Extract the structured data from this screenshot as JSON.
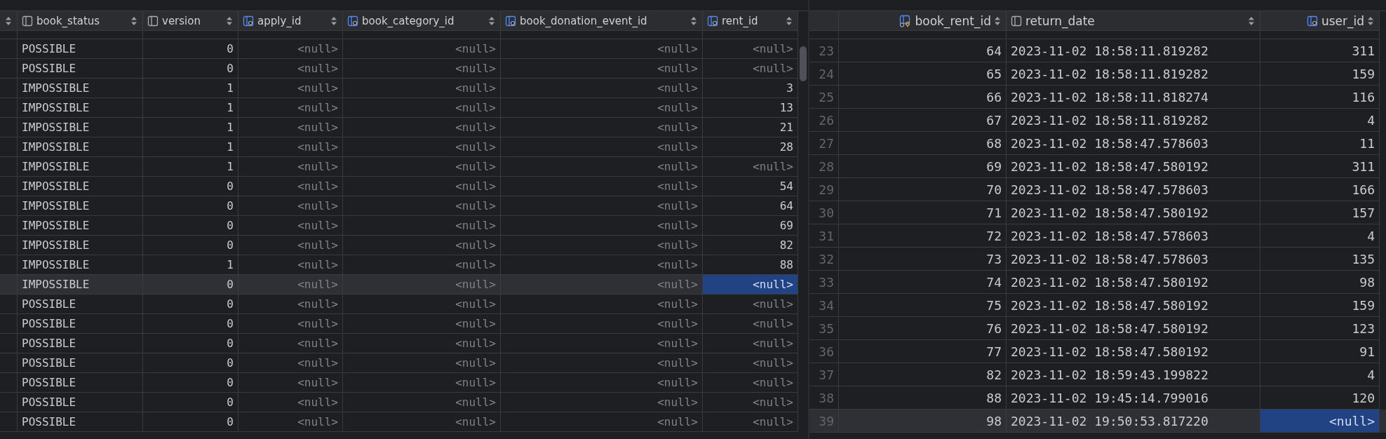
{
  "left_table": {
    "columns": [
      {
        "name": "book_status",
        "kind": "column",
        "numeric": false
      },
      {
        "name": "version",
        "kind": "column",
        "numeric": true
      },
      {
        "name": "apply_id",
        "kind": "fk",
        "numeric": true
      },
      {
        "name": "book_category_id",
        "kind": "fk",
        "numeric": true
      },
      {
        "name": "book_donation_event_id",
        "kind": "fk",
        "numeric": true
      },
      {
        "name": "rent_id",
        "kind": "fk",
        "numeric": true
      }
    ],
    "rows": [
      {
        "selected": false,
        "cells": [
          "POSSIBLE",
          "0",
          {
            "v": "<null>",
            "null": true
          },
          {
            "v": "<null>",
            "null": true
          },
          {
            "v": "<null>",
            "null": true
          },
          {
            "v": "<null>",
            "null": true
          }
        ]
      },
      {
        "selected": false,
        "cells": [
          "POSSIBLE",
          "0",
          {
            "v": "<null>",
            "null": true
          },
          {
            "v": "<null>",
            "null": true
          },
          {
            "v": "<null>",
            "null": true
          },
          {
            "v": "<null>",
            "null": true
          }
        ]
      },
      {
        "selected": false,
        "cells": [
          "IMPOSSIBLE",
          "1",
          {
            "v": "<null>",
            "null": true
          },
          {
            "v": "<null>",
            "null": true
          },
          {
            "v": "<null>",
            "null": true
          },
          "3"
        ]
      },
      {
        "selected": false,
        "cells": [
          "IMPOSSIBLE",
          "1",
          {
            "v": "<null>",
            "null": true
          },
          {
            "v": "<null>",
            "null": true
          },
          {
            "v": "<null>",
            "null": true
          },
          "13"
        ]
      },
      {
        "selected": false,
        "cells": [
          "IMPOSSIBLE",
          "1",
          {
            "v": "<null>",
            "null": true
          },
          {
            "v": "<null>",
            "null": true
          },
          {
            "v": "<null>",
            "null": true
          },
          "21"
        ]
      },
      {
        "selected": false,
        "cells": [
          "IMPOSSIBLE",
          "1",
          {
            "v": "<null>",
            "null": true
          },
          {
            "v": "<null>",
            "null": true
          },
          {
            "v": "<null>",
            "null": true
          },
          "28"
        ]
      },
      {
        "selected": false,
        "cells": [
          "IMPOSSIBLE",
          "1",
          {
            "v": "<null>",
            "null": true
          },
          {
            "v": "<null>",
            "null": true
          },
          {
            "v": "<null>",
            "null": true
          },
          {
            "v": "<null>",
            "null": true
          }
        ]
      },
      {
        "selected": false,
        "cells": [
          "IMPOSSIBLE",
          "0",
          {
            "v": "<null>",
            "null": true
          },
          {
            "v": "<null>",
            "null": true
          },
          {
            "v": "<null>",
            "null": true
          },
          "54"
        ]
      },
      {
        "selected": false,
        "cells": [
          "IMPOSSIBLE",
          "0",
          {
            "v": "<null>",
            "null": true
          },
          {
            "v": "<null>",
            "null": true
          },
          {
            "v": "<null>",
            "null": true
          },
          "64"
        ]
      },
      {
        "selected": false,
        "cells": [
          "IMPOSSIBLE",
          "0",
          {
            "v": "<null>",
            "null": true
          },
          {
            "v": "<null>",
            "null": true
          },
          {
            "v": "<null>",
            "null": true
          },
          "69"
        ]
      },
      {
        "selected": false,
        "cells": [
          "IMPOSSIBLE",
          "0",
          {
            "v": "<null>",
            "null": true
          },
          {
            "v": "<null>",
            "null": true
          },
          {
            "v": "<null>",
            "null": true
          },
          "82"
        ]
      },
      {
        "selected": false,
        "cells": [
          "IMPOSSIBLE",
          "1",
          {
            "v": "<null>",
            "null": true
          },
          {
            "v": "<null>",
            "null": true
          },
          {
            "v": "<null>",
            "null": true
          },
          "88"
        ]
      },
      {
        "selected": true,
        "cells": [
          "IMPOSSIBLE",
          "0",
          {
            "v": "<null>",
            "null": true
          },
          {
            "v": "<null>",
            "null": true
          },
          {
            "v": "<null>",
            "null": true
          },
          {
            "v": "<null>",
            "null": true,
            "selected": true
          }
        ]
      },
      {
        "selected": false,
        "cells": [
          "POSSIBLE",
          "0",
          {
            "v": "<null>",
            "null": true
          },
          {
            "v": "<null>",
            "null": true
          },
          {
            "v": "<null>",
            "null": true
          },
          {
            "v": "<null>",
            "null": true
          }
        ]
      },
      {
        "selected": false,
        "cells": [
          "POSSIBLE",
          "0",
          {
            "v": "<null>",
            "null": true
          },
          {
            "v": "<null>",
            "null": true
          },
          {
            "v": "<null>",
            "null": true
          },
          {
            "v": "<null>",
            "null": true
          }
        ]
      },
      {
        "selected": false,
        "cells": [
          "POSSIBLE",
          "0",
          {
            "v": "<null>",
            "null": true
          },
          {
            "v": "<null>",
            "null": true
          },
          {
            "v": "<null>",
            "null": true
          },
          {
            "v": "<null>",
            "null": true
          }
        ]
      },
      {
        "selected": false,
        "cells": [
          "POSSIBLE",
          "0",
          {
            "v": "<null>",
            "null": true
          },
          {
            "v": "<null>",
            "null": true
          },
          {
            "v": "<null>",
            "null": true
          },
          {
            "v": "<null>",
            "null": true
          }
        ]
      },
      {
        "selected": false,
        "cells": [
          "POSSIBLE",
          "0",
          {
            "v": "<null>",
            "null": true
          },
          {
            "v": "<null>",
            "null": true
          },
          {
            "v": "<null>",
            "null": true
          },
          {
            "v": "<null>",
            "null": true
          }
        ]
      },
      {
        "selected": false,
        "cells": [
          "POSSIBLE",
          "0",
          {
            "v": "<null>",
            "null": true
          },
          {
            "v": "<null>",
            "null": true
          },
          {
            "v": "<null>",
            "null": true
          },
          {
            "v": "<null>",
            "null": true
          }
        ]
      },
      {
        "selected": false,
        "cells": [
          "POSSIBLE",
          "0",
          {
            "v": "<null>",
            "null": true
          },
          {
            "v": "<null>",
            "null": true
          },
          {
            "v": "<null>",
            "null": true
          },
          {
            "v": "<null>",
            "null": true
          }
        ]
      }
    ]
  },
  "right_table": {
    "columns": [
      {
        "name": "book_rent_id",
        "kind": "pk",
        "numeric": true
      },
      {
        "name": "return_date",
        "kind": "column",
        "numeric": false
      },
      {
        "name": "user_id",
        "kind": "fk",
        "numeric": true
      }
    ],
    "rows": [
      {
        "num": "23",
        "selected": false,
        "cells": [
          "64",
          "2023-11-02 18:58:11.819282",
          "311"
        ]
      },
      {
        "num": "24",
        "selected": false,
        "cells": [
          "65",
          "2023-11-02 18:58:11.819282",
          "159"
        ]
      },
      {
        "num": "25",
        "selected": false,
        "cells": [
          "66",
          "2023-11-02 18:58:11.818274",
          "116"
        ]
      },
      {
        "num": "26",
        "selected": false,
        "cells": [
          "67",
          "2023-11-02 18:58:11.819282",
          "4"
        ]
      },
      {
        "num": "27",
        "selected": false,
        "cells": [
          "68",
          "2023-11-02 18:58:47.578603",
          "11"
        ]
      },
      {
        "num": "28",
        "selected": false,
        "cells": [
          "69",
          "2023-11-02 18:58:47.580192",
          "311"
        ]
      },
      {
        "num": "29",
        "selected": false,
        "cells": [
          "70",
          "2023-11-02 18:58:47.578603",
          "166"
        ]
      },
      {
        "num": "30",
        "selected": false,
        "cells": [
          "71",
          "2023-11-02 18:58:47.580192",
          "157"
        ]
      },
      {
        "num": "31",
        "selected": false,
        "cells": [
          "72",
          "2023-11-02 18:58:47.578603",
          "4"
        ]
      },
      {
        "num": "32",
        "selected": false,
        "cells": [
          "73",
          "2023-11-02 18:58:47.578603",
          "135"
        ]
      },
      {
        "num": "33",
        "selected": false,
        "cells": [
          "74",
          "2023-11-02 18:58:47.580192",
          "98"
        ]
      },
      {
        "num": "34",
        "selected": false,
        "cells": [
          "75",
          "2023-11-02 18:58:47.580192",
          "159"
        ]
      },
      {
        "num": "35",
        "selected": false,
        "cells": [
          "76",
          "2023-11-02 18:58:47.580192",
          "123"
        ]
      },
      {
        "num": "36",
        "selected": false,
        "cells": [
          "77",
          "2023-11-02 18:58:47.580192",
          "91"
        ]
      },
      {
        "num": "37",
        "selected": false,
        "cells": [
          "82",
          "2023-11-02 18:59:43.199822",
          "4"
        ]
      },
      {
        "num": "38",
        "selected": false,
        "cells": [
          "88",
          "2023-11-02 19:45:14.799016",
          "120"
        ]
      },
      {
        "num": "39",
        "selected": true,
        "cells": [
          "98",
          "2023-11-02 19:50:53.817220",
          {
            "v": "<null>",
            "null": true,
            "selected": true
          }
        ]
      }
    ]
  }
}
